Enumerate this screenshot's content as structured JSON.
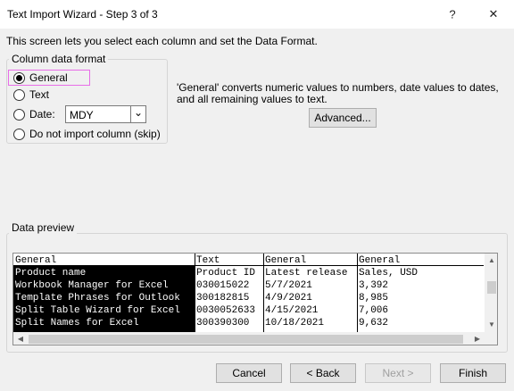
{
  "window": {
    "title": "Text Import Wizard - Step 3 of 3",
    "help_glyph": "?",
    "close_glyph": "✕"
  },
  "intro_text": "This screen lets you select each column and set the Data Format.",
  "column_format": {
    "legend": "Column data format",
    "options": [
      {
        "label": "General",
        "checked": true
      },
      {
        "label": "Text",
        "checked": false
      },
      {
        "label": "Date:",
        "checked": false
      },
      {
        "label": "Do not import column (skip)",
        "checked": false
      }
    ],
    "date_select": {
      "value": "MDY",
      "arrow_glyph": "⌄"
    }
  },
  "description": "'General' converts numeric values to numbers, date values to dates, and all remaining values to text.",
  "advanced_button": "Advanced...",
  "data_preview": {
    "legend": "Data preview",
    "column_labels": [
      "General",
      "Text",
      "General",
      "General"
    ],
    "rows": [
      [
        "Product name",
        "Product ID",
        "Latest release",
        "Sales, USD"
      ],
      [
        "Workbook Manager for Excel",
        "030015022",
        "5/7/2021",
        "3,392"
      ],
      [
        "Template Phrases for Outlook",
        "300182815",
        "4/9/2021",
        "8,985"
      ],
      [
        "Split Table Wizard for Excel",
        "0030052633",
        "4/15/2021",
        "7,006"
      ],
      [
        "Split Names for Excel",
        "300390300",
        "10/18/2021",
        "9,632"
      ]
    ],
    "scroll_glyphs": {
      "up": "▲",
      "down": "▼",
      "left": "◀",
      "right": "▶"
    }
  },
  "footer_buttons": {
    "cancel": "Cancel",
    "back": "< Back",
    "next": "Next >",
    "finish": "Finish"
  }
}
